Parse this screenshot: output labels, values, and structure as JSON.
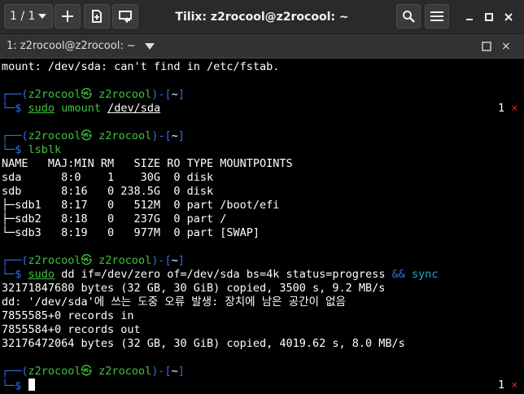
{
  "titlebar": {
    "session_label": "1 / 1",
    "title": "Tilix: z2rocool@z2rocool: ~"
  },
  "terminal_header": {
    "title": "1: z2rocool@z2rocool: ~"
  },
  "prompt": {
    "frame_top": "┌──",
    "open": "(",
    "user_host": "z2rocool㉿ z2rocool",
    "close": ")",
    "dash": "-",
    "dir_open": "[",
    "dir": "~",
    "dir_close": "]",
    "frame_bottom": "└─",
    "symbol": "$"
  },
  "lines": {
    "l1": "mount: /dev/sda: can't find in /etc/fstab.",
    "cmd1_sudo": "sudo",
    "cmd1_rest_a": " umount ",
    "cmd1_arg": "/dev/sda",
    "cmd2": "lsblk",
    "lsblk_header": "NAME   MAJ:MIN RM   SIZE RO TYPE MOUNTPOINTS",
    "lsblk_sda": "sda      8:0    1    30G  0 disk",
    "lsblk_sdb": "sdb      8:16   0 238.5G  0 disk",
    "lsblk_sdb1": "├─sdb1   8:17   0   512M  0 part /boot/efi",
    "lsblk_sdb2": "├─sdb2   8:18   0   237G  0 part /",
    "lsblk_sdb3": "└─sdb3   8:19   0   977M  0 part [SWAP]",
    "cmd3_sudo": "sudo",
    "cmd3_a": " dd if=/dev/zero of=/dev/sda bs=4k status=progress ",
    "cmd3_amp": "&&",
    "cmd3_sync": " sync",
    "out1": "32171847680 bytes (32 GB, 30 GiB) copied, 3500 s, 9.2 MB/s",
    "out2": "dd: '/dev/sda'에 쓰는 도중 오류 발생: 장치에 남은 공간이 없음",
    "out3": "7855585+0 records in",
    "out4": "7855584+0 records out",
    "out5": "32176472064 bytes (32 GB, 30 GiB) copied, 4019.62 s, 8.0 MB/s"
  },
  "status": {
    "code": "1",
    "mark": "×"
  },
  "colors": {
    "prompt_frame": "#2f6fe6",
    "user": "#3ec43e",
    "error_mark": "#e02020",
    "sync": "#2aa8c8"
  }
}
